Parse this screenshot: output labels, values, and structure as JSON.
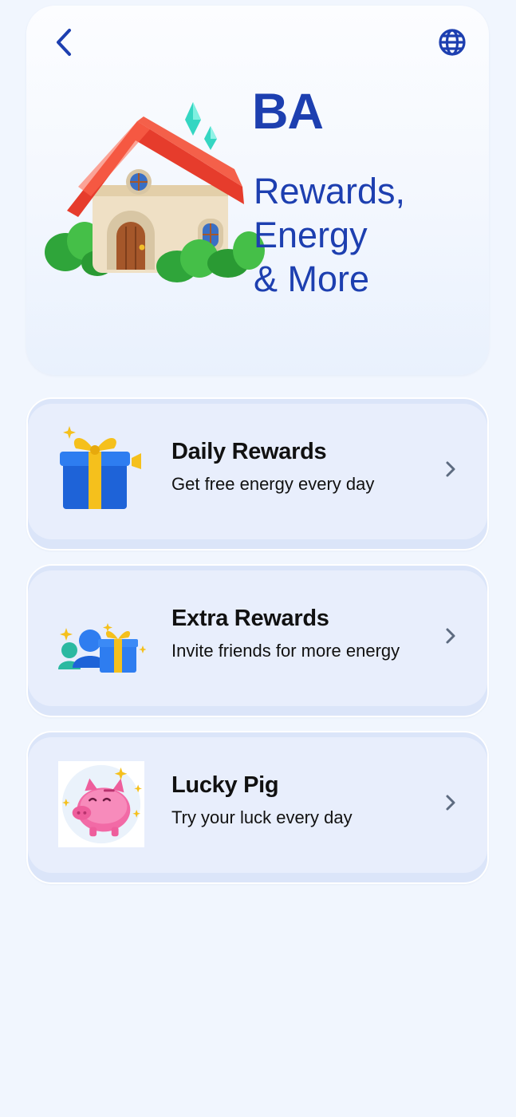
{
  "header": {
    "back_icon": "chevron-left-icon",
    "language_icon": "globe-icon",
    "title": "BA",
    "subtitle": "Rewards,\nEnergy\n& More",
    "accent_color": "#1d3fb0"
  },
  "cards": [
    {
      "title": "Daily Rewards",
      "description": "Get free energy every day",
      "icon": "gift-box-icon"
    },
    {
      "title": "Extra Rewards",
      "description": "Invite friends for more energy",
      "icon": "invite-friends-icon"
    },
    {
      "title": "Lucky Pig",
      "description": "Try your luck every day",
      "icon": "piggy-bank-icon"
    }
  ]
}
